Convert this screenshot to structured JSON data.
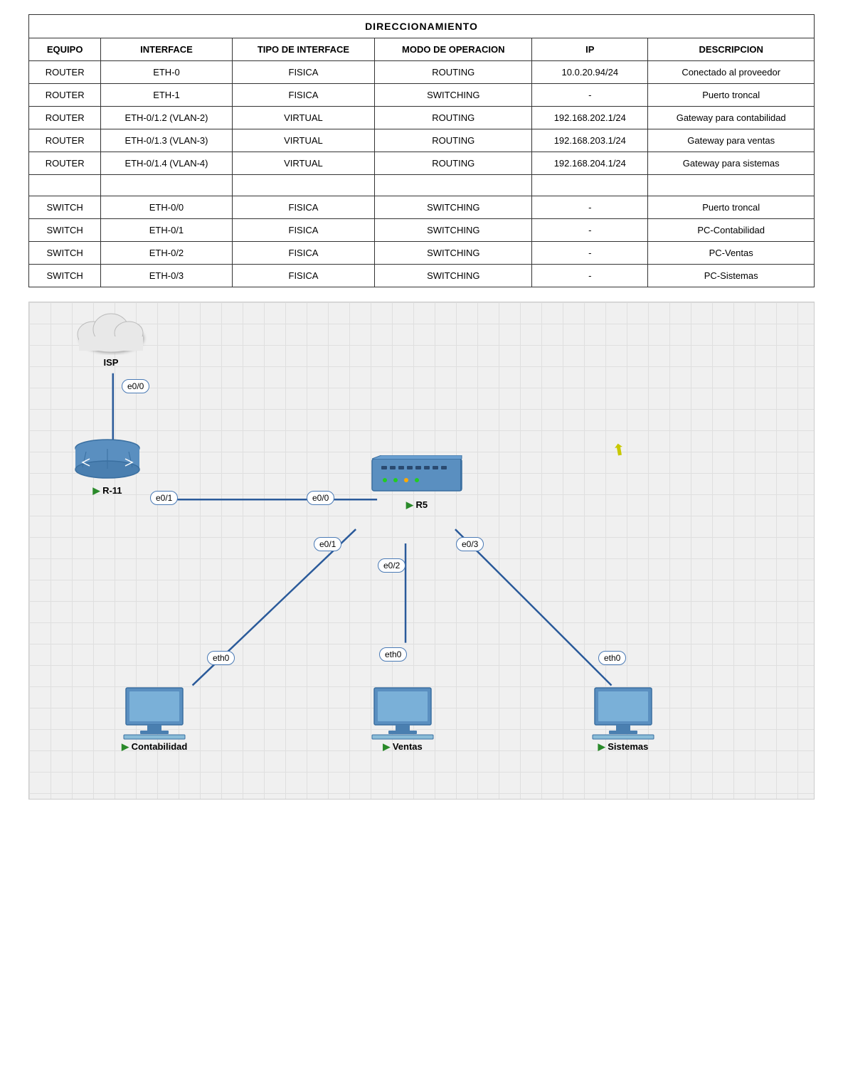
{
  "table": {
    "title": "DIRECCIONAMIENTO",
    "headers": [
      "EQUIPO",
      "INTERFACE",
      "TIPO DE INTERFACE",
      "MODO DE OPERACION",
      "IP",
      "DESCRIPCION"
    ],
    "rows": [
      [
        "ROUTER",
        "ETH-0",
        "FISICA",
        "ROUTING",
        "10.0.20.94/24",
        "Conectado al proveedor"
      ],
      [
        "ROUTER",
        "ETH-1",
        "FISICA",
        "SWITCHING",
        "-",
        "Puerto troncal"
      ],
      [
        "ROUTER",
        "ETH-0/1.2 (VLAN-2)",
        "VIRTUAL",
        "ROUTING",
        "192.168.202.1/24",
        "Gateway para contabilidad"
      ],
      [
        "ROUTER",
        "ETH-0/1.3 (VLAN-3)",
        "VIRTUAL",
        "ROUTING",
        "192.168.203.1/24",
        "Gateway para ventas"
      ],
      [
        "ROUTER",
        "ETH-0/1.4 (VLAN-4)",
        "VIRTUAL",
        "ROUTING",
        "192.168.204.1/24",
        "Gateway para sistemas"
      ],
      [
        "",
        "",
        "",
        "",
        "",
        ""
      ],
      [
        "SWITCH",
        "ETH-0/0",
        "FISICA",
        "SWITCHING",
        "-",
        "Puerto troncal"
      ],
      [
        "SWITCH",
        "ETH-0/1",
        "FISICA",
        "SWITCHING",
        "-",
        "PC-Contabilidad"
      ],
      [
        "SWITCH",
        "ETH-0/2",
        "FISICA",
        "SWITCHING",
        "-",
        "PC-Ventas"
      ],
      [
        "SWITCH",
        "ETH-0/3",
        "FISICA",
        "SWITCHING",
        "-",
        "PC-Sistemas"
      ]
    ]
  },
  "diagram": {
    "nodes": {
      "isp": {
        "label": "ISP",
        "type": "cloud"
      },
      "router_r11": {
        "label": "R-11",
        "type": "router"
      },
      "router_r5": {
        "label": "R5",
        "type": "router"
      },
      "contabilidad": {
        "label": "Contabilidad",
        "type": "pc"
      },
      "ventas": {
        "label": "Ventas",
        "type": "pc"
      },
      "sistemas": {
        "label": "Sistemas",
        "type": "pc"
      }
    },
    "ports": {
      "e00_r11": "e0/0",
      "e01_r11": "e0/1",
      "e00_r5": "e0/0",
      "e01_r5": "e0/1",
      "e02_r5": "e0/2",
      "e03_r5": "e0/3",
      "eth0_cont": "eth0",
      "eth0_vent": "eth0",
      "eth0_sist": "eth0"
    }
  }
}
